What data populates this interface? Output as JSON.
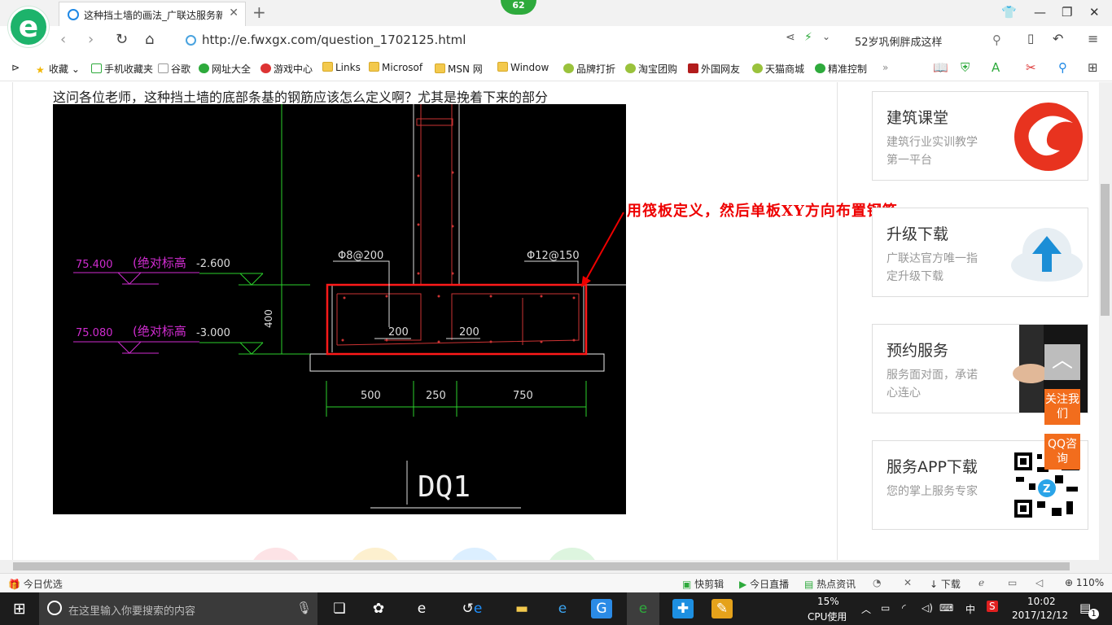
{
  "browser": {
    "tab_title": "这种挡土墙的画法_广联达服务新",
    "badge": "62",
    "url": "http://e.fwxgx.com/question_1702125.html",
    "search_value": "52岁巩俐胖成这样"
  },
  "bookmarks": [
    "收藏",
    "手机收藏夹",
    "谷歌",
    "网址大全",
    "游戏中心",
    "Links",
    "Microsof",
    "MSN 网",
    "Window",
    "品牌打折",
    "淘宝团购",
    "外国网友",
    "天猫商城",
    "精准控制"
  ],
  "page": {
    "question_text": "这问各位老师，这种挡土墙的底部条基的钢筋应该怎么定义啊？尤其是挽着下来的部分",
    "annotation": "用筏板定义，然后单板XY方向布置钢筋"
  },
  "cad": {
    "label_75400": "75.400",
    "label_abs1": "(绝对标高",
    "label_m2600": "-2.600",
    "label_75080": "75.080",
    "label_abs2": "(绝对标高",
    "label_m3000": "-3.000",
    "rebar1": "Φ8@200",
    "rebar2": "Φ12@150",
    "dim_400": "400",
    "dim_200a": "200",
    "dim_200b": "200",
    "dim_500": "500",
    "dim_250": "250",
    "dim_750": "750",
    "title": "DQ1"
  },
  "sidebar": {
    "card1_title": "建筑课堂",
    "card1_desc": "建筑行业实训教学第一平台",
    "card2_title": "升级下载",
    "card2_desc": "广联达官方唯一指定升级下载",
    "card3_title": "预约服务",
    "card3_desc": "服务面对面，承诺心连心",
    "card4_title": "服务APP下载",
    "card4_desc": "您的掌上服务专家",
    "follow_label": "关注我们",
    "qq_label": "QQ咨询"
  },
  "statusbar": {
    "left": "今日优选",
    "items": [
      "快剪辑",
      "今日直播",
      "热点资讯",
      "下载"
    ],
    "zoom": "110%"
  },
  "taskbar": {
    "search_placeholder": "在这里输入你要搜索的内容",
    "cpu_percent": "15%",
    "cpu_label": "CPU使用",
    "ime": "中",
    "time": "10:02",
    "date": "2017/12/12",
    "notifications": "1"
  }
}
